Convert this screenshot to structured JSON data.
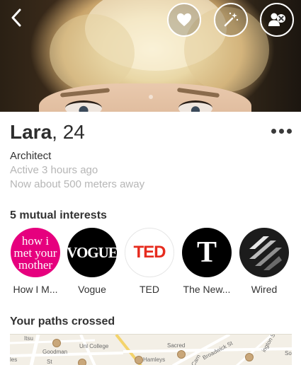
{
  "profile": {
    "name": "Lara",
    "age": ", 24",
    "job": "Architect",
    "active": "Active 3 hours ago",
    "distance": "Now about 500 meters away"
  },
  "photo": {
    "page_count": 2,
    "current_page": 1
  },
  "actions": {
    "back": "back-chevron-icon",
    "like": "heart-icon",
    "boost": "magic-wand-icon",
    "block": "block-user-icon"
  },
  "interests": {
    "title": "5 mutual interests",
    "items": [
      {
        "label": "How I M...",
        "logo_text": [
          "how i",
          "met your",
          "mother"
        ],
        "color": "#e6007e"
      },
      {
        "label": "Vogue",
        "logo_text": "VOGUE",
        "color": "#000000"
      },
      {
        "label": "TED",
        "logo_text": "TED",
        "color": "#e62b1e"
      },
      {
        "label": "The New...",
        "logo_text": "T",
        "color": "#000000"
      },
      {
        "label": "Wired",
        "logo_text": "",
        "color": "#1c1c1c"
      }
    ]
  },
  "paths": {
    "title": "Your paths crossed",
    "map_labels": [
      "Itsu",
      "Goodman",
      "Unl College",
      "Sacred",
      "Broadwick St",
      "Hamleys",
      "ington St",
      "les",
      "St",
      "Carn",
      "So"
    ]
  }
}
